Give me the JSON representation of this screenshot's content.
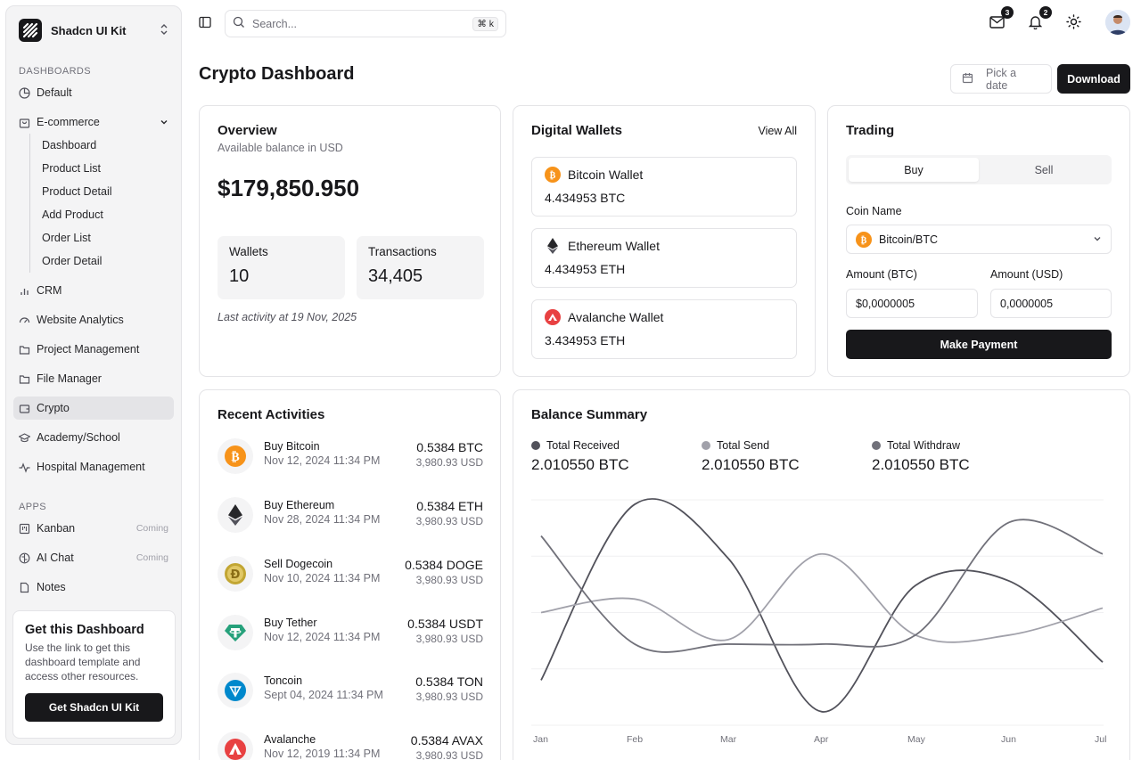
{
  "brand": {
    "name": "Shadcn UI Kit"
  },
  "sidebar": {
    "dashboards_label": "DASHBOARDS",
    "apps_label": "APPS",
    "default": "Default",
    "ecommerce": "E-commerce",
    "ecommerce_sub": [
      "Dashboard",
      "Product List",
      "Product Detail",
      "Add Product",
      "Order List",
      "Order Detail"
    ],
    "crm": "CRM",
    "website_analytics": "Website Analytics",
    "project_management": "Project Management",
    "file_manager": "File Manager",
    "crypto": "Crypto",
    "academy": "Academy/School",
    "hospital": "Hospital Management",
    "kanban": "Kanban",
    "kanban_tag": "Coming",
    "ai_chat": "AI Chat",
    "ai_chat_tag": "Coming",
    "notes": "Notes"
  },
  "promo": {
    "title": "Get this Dashboard",
    "text": "Use the link to get this dashboard template and access other resources.",
    "button": "Get Shadcn UI Kit"
  },
  "topbar": {
    "search_placeholder": "Search...",
    "shortcut": "⌘ k",
    "mail_count": "3",
    "notif_count": "2"
  },
  "header": {
    "title": "Crypto Dashboard",
    "date_placeholder": "Pick a date",
    "download": "Download"
  },
  "overview": {
    "title": "Overview",
    "subtitle": "Available balance in USD",
    "balance": "$179,850.950",
    "wallets_label": "Wallets",
    "wallets_value": "10",
    "transactions_label": "Transactions",
    "transactions_value": "34,405",
    "last_activity": "Last activity at 19 Nov, 2025"
  },
  "wallets": {
    "title": "Digital Wallets",
    "view_all": "View All",
    "items": [
      {
        "name": "Bitcoin Wallet",
        "amount": "4.434953 BTC"
      },
      {
        "name": "Ethereum Wallet",
        "amount": "4.434953 ETH"
      },
      {
        "name": "Avalanche Wallet",
        "amount": "3.434953 ETH"
      }
    ]
  },
  "trading": {
    "title": "Trading",
    "buy": "Buy",
    "sell": "Sell",
    "coin_label": "Coin Name",
    "coin_value": "Bitcoin/BTC",
    "amount_btc_label": "Amount (BTC)",
    "amount_usd_label": "Amount (USD)",
    "amount_btc_value": "$0,0000005",
    "amount_usd_value": "0,0000005",
    "submit": "Make Payment"
  },
  "activities": {
    "title": "Recent Activities",
    "items": [
      {
        "title": "Buy Bitcoin",
        "date": "Nov 12, 2024 11:34 PM",
        "amount": "0.5384 BTC",
        "usd": "3,980.93 USD"
      },
      {
        "title": "Buy Ethereum",
        "date": "Nov 28, 2024 11:34 PM",
        "amount": "0.5384 ETH",
        "usd": "3,980.93 USD"
      },
      {
        "title": "Sell Dogecoin",
        "date": "Nov 10, 2024 11:34 PM",
        "amount": "0.5384 DOGE",
        "usd": "3,980.93 USD"
      },
      {
        "title": "Buy Tether",
        "date": "Nov 12, 2024 11:34 PM",
        "amount": "0.5384 USDT",
        "usd": "3,980.93 USD"
      },
      {
        "title": "Toncoin",
        "date": "Sept 04, 2024 11:34 PM",
        "amount": "0.5384 TON",
        "usd": "3,980.93 USD"
      },
      {
        "title": "Avalanche",
        "date": "Nov 12, 2019 11:34 PM",
        "amount": "0.5384 AVAX",
        "usd": "3,980.93 USD"
      }
    ]
  },
  "balance": {
    "title": "Balance Summary",
    "legend": [
      {
        "label": "Total Received",
        "value": "2.010550 BTC",
        "color": "#52525b"
      },
      {
        "label": "Total Send",
        "value": "2.010550 BTC",
        "color": "#a1a1aa"
      },
      {
        "label": "Total Withdraw",
        "value": "2.010550 BTC",
        "color": "#71717a"
      }
    ]
  },
  "chart_data": {
    "type": "line",
    "x": [
      "Jan",
      "Feb",
      "Mar",
      "Apr",
      "May",
      "Jun",
      "Jul"
    ],
    "ylim": [
      0,
      100
    ],
    "grid": true,
    "series": [
      {
        "name": "Total Received",
        "color": "#52525b",
        "values": [
          20,
          98,
          74,
          6,
          62,
          64,
          28
        ]
      },
      {
        "name": "Total Send",
        "color": "#a1a1aa",
        "values": [
          50,
          56,
          38,
          76,
          40,
          40,
          52
        ]
      },
      {
        "name": "Total Withdraw",
        "color": "#71717a",
        "values": [
          84,
          36,
          36,
          36,
          40,
          90,
          76
        ]
      }
    ]
  }
}
